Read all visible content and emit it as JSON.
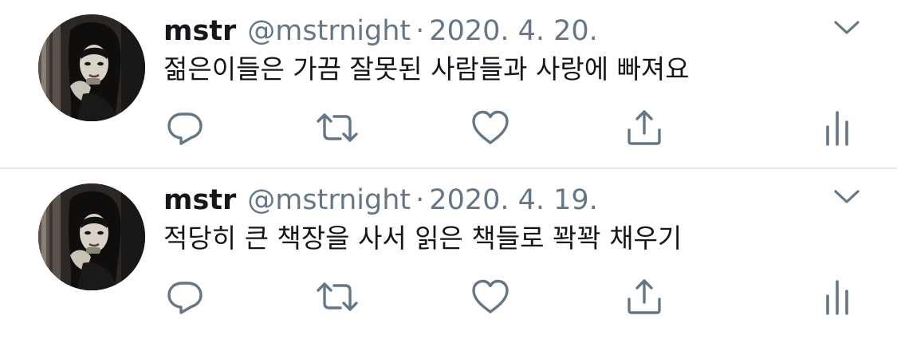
{
  "tweets": [
    {
      "display_name": "mstr",
      "handle": "@mstrnight",
      "separator": "·",
      "date": "2020. 4. 20.",
      "text": "젊은이들은 가끔 잘못된 사람들과 사랑에 빠져요",
      "avatar_icon": "profile-photo",
      "actions": [
        "reply-icon",
        "retweet-icon",
        "like-icon",
        "share-icon",
        "analytics-icon"
      ]
    },
    {
      "display_name": "mstr",
      "handle": "@mstrnight",
      "separator": "·",
      "date": "2020. 4. 19.",
      "text": "적당히 큰 책장을 사서 읽은 책들로 꽉꽉 채우기",
      "avatar_icon": "profile-photo",
      "actions": [
        "reply-icon",
        "retweet-icon",
        "like-icon",
        "share-icon",
        "analytics-icon"
      ]
    }
  ],
  "colors": {
    "text_primary": "#14171a",
    "text_secondary": "#657786",
    "icon": "#657786",
    "divider": "#e1e8ed",
    "background": "#ffffff"
  }
}
